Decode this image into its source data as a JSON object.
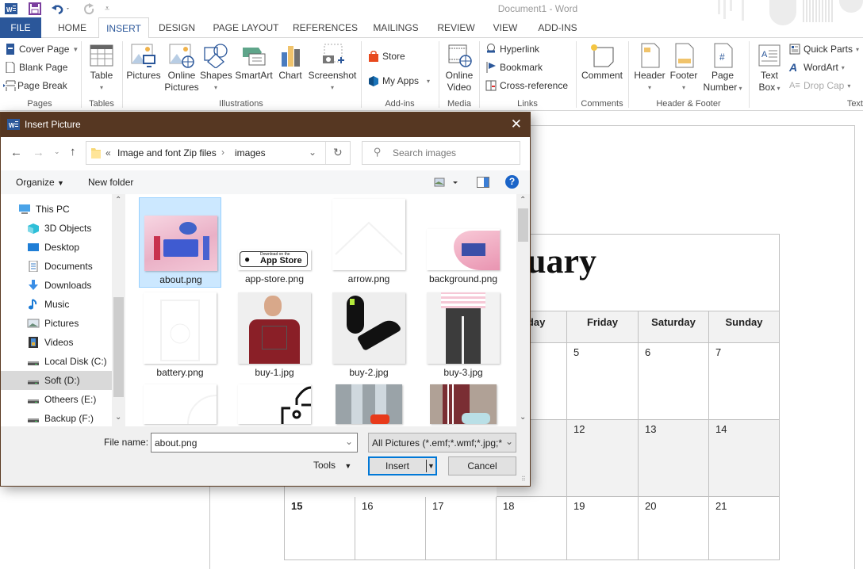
{
  "app": {
    "window_title": "Document1 - Word",
    "quick_access": [
      "word-logo-icon",
      "save-icon",
      "undo-icon",
      "redo-icon",
      "customize-qat-icon"
    ]
  },
  "tabs": [
    {
      "label": "FILE",
      "state": "file"
    },
    {
      "label": "HOME"
    },
    {
      "label": "INSERT",
      "state": "active"
    },
    {
      "label": "DESIGN"
    },
    {
      "label": "PAGE LAYOUT"
    },
    {
      "label": "REFERENCES"
    },
    {
      "label": "MAILINGS"
    },
    {
      "label": "REVIEW"
    },
    {
      "label": "VIEW"
    },
    {
      "label": "ADD-INS"
    }
  ],
  "ribbon": {
    "pages": {
      "label": "Pages",
      "items": [
        "Cover Page",
        "Blank Page",
        "Page Break"
      ]
    },
    "tables": {
      "label": "Tables",
      "items": [
        "Table"
      ]
    },
    "illustrations": {
      "label": "Illustrations",
      "items": [
        "Pictures",
        "Online\nPictures",
        "Shapes",
        "SmartArt",
        "Chart",
        "Screenshot"
      ],
      "online_pictures_l1": "Online",
      "online_pictures_l2": "Pictures"
    },
    "addins": {
      "label": "Add-ins",
      "items": [
        "Store",
        "My Apps"
      ]
    },
    "media": {
      "label": "Media",
      "items": [
        "Online",
        "Video"
      ]
    },
    "links": {
      "label": "Links",
      "items": [
        "Hyperlink",
        "Bookmark",
        "Cross-reference"
      ]
    },
    "comments": {
      "label": "Comments",
      "items": [
        "Comment"
      ]
    },
    "header_footer": {
      "label": "Header & Footer",
      "items": [
        "Header",
        "Footer",
        "Page",
        "Number"
      ]
    },
    "text": {
      "label": "Text",
      "items": [
        "Text",
        "Box",
        "Quick Parts",
        "WordArt",
        "Drop Cap"
      ]
    }
  },
  "dialog": {
    "title": "Insert Picture",
    "breadcrumb": {
      "overflow": "«",
      "parts": [
        "Image and font Zip files",
        "images"
      ],
      "separator": "›"
    },
    "search_placeholder": "Search images",
    "toolbar": {
      "organize": "Organize",
      "new_folder": "New folder"
    },
    "nav_items": [
      {
        "label": "This PC",
        "icon": "computer-icon"
      },
      {
        "label": "3D Objects",
        "icon": "cube-icon"
      },
      {
        "label": "Desktop",
        "icon": "desktop-icon"
      },
      {
        "label": "Documents",
        "icon": "documents-icon"
      },
      {
        "label": "Downloads",
        "icon": "download-arrow-icon"
      },
      {
        "label": "Music",
        "icon": "music-note-icon"
      },
      {
        "label": "Pictures",
        "icon": "pictures-icon"
      },
      {
        "label": "Videos",
        "icon": "film-icon"
      },
      {
        "label": "Local Disk (C:)",
        "icon": "drive-icon"
      },
      {
        "label": "Soft (D:)",
        "icon": "drive-icon",
        "selected": true
      },
      {
        "label": "Otheers (E:)",
        "icon": "drive-icon"
      },
      {
        "label": "Backup (F:)",
        "icon": "drive-icon"
      }
    ],
    "files": [
      {
        "name": "about.png",
        "selected": true
      },
      {
        "name": "app-store.png",
        "badge_small": "Download on the",
        "badge_big": "App Store"
      },
      {
        "name": "arrow.png"
      },
      {
        "name": "background.png"
      },
      {
        "name": "battery.png"
      },
      {
        "name": "buy-1.jpg"
      },
      {
        "name": "buy-2.jpg"
      },
      {
        "name": "buy-3.jpg"
      },
      {
        "name": ""
      },
      {
        "name": ""
      },
      {
        "name": ""
      },
      {
        "name": ""
      }
    ],
    "file_name_label": "File name:",
    "file_name_value": "about.png",
    "file_type": "All Pictures (*.emf;*.wmf;*.jpg;*",
    "tools_label": "Tools",
    "insert_label": "Insert",
    "cancel_label": "Cancel"
  },
  "document": {
    "calendar_title_fragment": "uary",
    "day_headers": [
      "rsday",
      "Friday",
      "Saturday",
      "Sunday"
    ],
    "weeks": [
      [
        "",
        "5",
        "6",
        "7"
      ],
      [
        "",
        "12",
        "13",
        "14"
      ],
      [
        "15",
        "16",
        "17",
        "18",
        "19",
        "20",
        "21"
      ]
    ]
  }
}
